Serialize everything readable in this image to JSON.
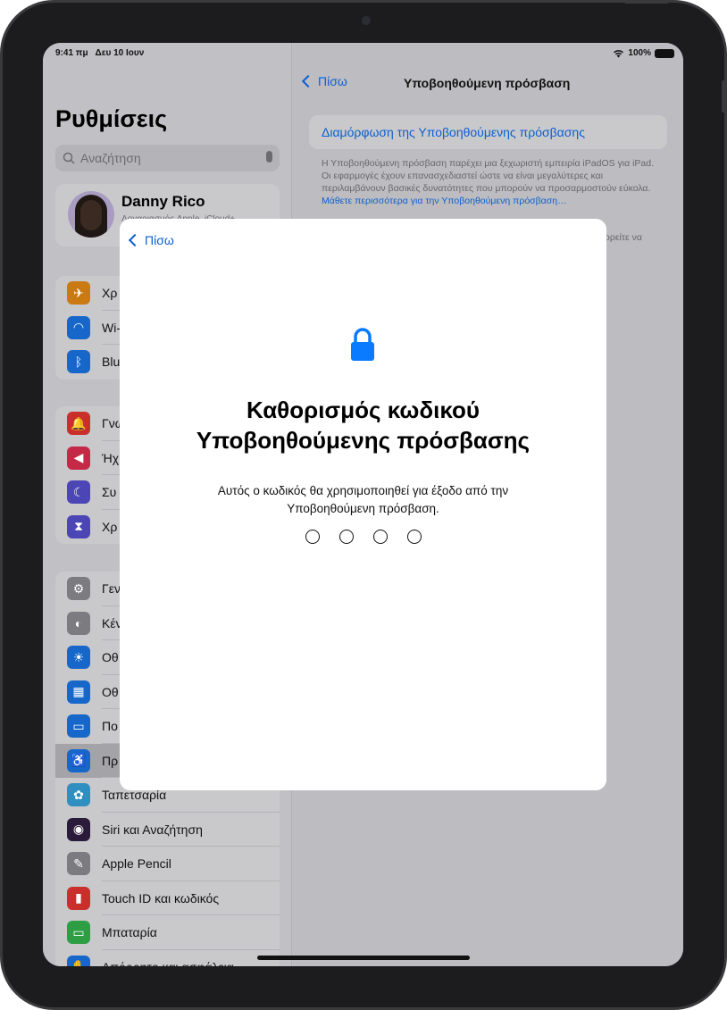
{
  "status": {
    "time": "9:41 πμ",
    "date": "Δευ 10 Ιουν",
    "battery": "100%"
  },
  "sidebar": {
    "title": "Ρυθμίσεις",
    "search_placeholder": "Αναζήτηση",
    "profile": {
      "name": "Danny Rico",
      "subtitle": "Λογαριασμός Apple, iCloud+"
    },
    "groups": [
      [
        {
          "label": "Χρ",
          "icon": "airplane-icon",
          "color": "#c97a12"
        },
        {
          "label": "Wi-",
          "icon": "wifi-icon",
          "color": "#1667c9"
        },
        {
          "label": "Blu",
          "icon": "bluetooth-icon",
          "color": "#1667c9"
        }
      ],
      [
        {
          "label": "Γνω",
          "icon": "notifications-icon",
          "color": "#c9302c"
        },
        {
          "label": "Ήχ",
          "icon": "sound-icon",
          "color": "#c42a47"
        },
        {
          "label": "Συ",
          "icon": "moon-icon",
          "color": "#4b45b5"
        },
        {
          "label": "Χρ",
          "icon": "hourglass-icon",
          "color": "#4b45b5"
        }
      ],
      [
        {
          "label": "Γεν",
          "icon": "gear-icon",
          "color": "#7b7b80"
        },
        {
          "label": "Κέν",
          "icon": "control-center-icon",
          "color": "#7b7b80"
        },
        {
          "label": "Οθ",
          "icon": "brightness-icon",
          "color": "#1667c9"
        },
        {
          "label": "Οθ",
          "icon": "home-screen-icon",
          "color": "#1667c9"
        },
        {
          "label": "Πο",
          "icon": "multitasking-icon",
          "color": "#1667c9"
        },
        {
          "label": "Πρ",
          "icon": "accessibility-icon",
          "color": "#1667c9",
          "selected": true
        },
        {
          "label": "Ταπετσαρία",
          "icon": "wallpaper-icon",
          "color": "#2f8fc0"
        },
        {
          "label": "Siri και Αναζήτηση",
          "icon": "siri-icon",
          "color": "#2a1b3a"
        },
        {
          "label": "Apple Pencil",
          "icon": "pencil-icon",
          "color": "#7b7b80"
        },
        {
          "label": "Touch ID και κωδικός",
          "icon": "lock-icon",
          "color": "#c9302c"
        },
        {
          "label": "Μπαταρία",
          "icon": "battery-icon",
          "color": "#2e9e45"
        },
        {
          "label": "Απόρρητο και ασφάλεια",
          "icon": "hand-icon",
          "color": "#1667c9"
        }
      ]
    ]
  },
  "detail": {
    "back": "Πίσω",
    "title": "Υποβοηθούμενη πρόσβαση",
    "configure": "Διαμόρφωση της Υποβοηθούμενης πρόσβασης",
    "description": "Η Υποβοηθούμενη πρόσβαση παρέχει μια ξεχωριστή εμπειρία iPadOS για iPad. Οι εφαρμογές έχουν επανασχεδιαστεί ώστε να είναι μεγαλύτερες και περιλαμβάνουν βασικές δυνατότητες που μπορούν να προσαρμοστούν εύκολα. ",
    "learn_more": "Μάθετε περισσότερα για την Υποβοηθούμενη πρόσβαση…",
    "fragment": "ορείτε να"
  },
  "modal": {
    "back": "Πίσω",
    "icon": "lock-icon",
    "title_line1": "Καθορισμός κωδικού",
    "title_line2": "Υποβοηθούμενης πρόσβασης",
    "description": "Αυτός ο κωδικός θα χρησιμοποιηθεί για έξοδο από την Υποβοηθούμενη πρόσβαση.",
    "passcode_length": 4,
    "accent": "#0a7aff"
  }
}
